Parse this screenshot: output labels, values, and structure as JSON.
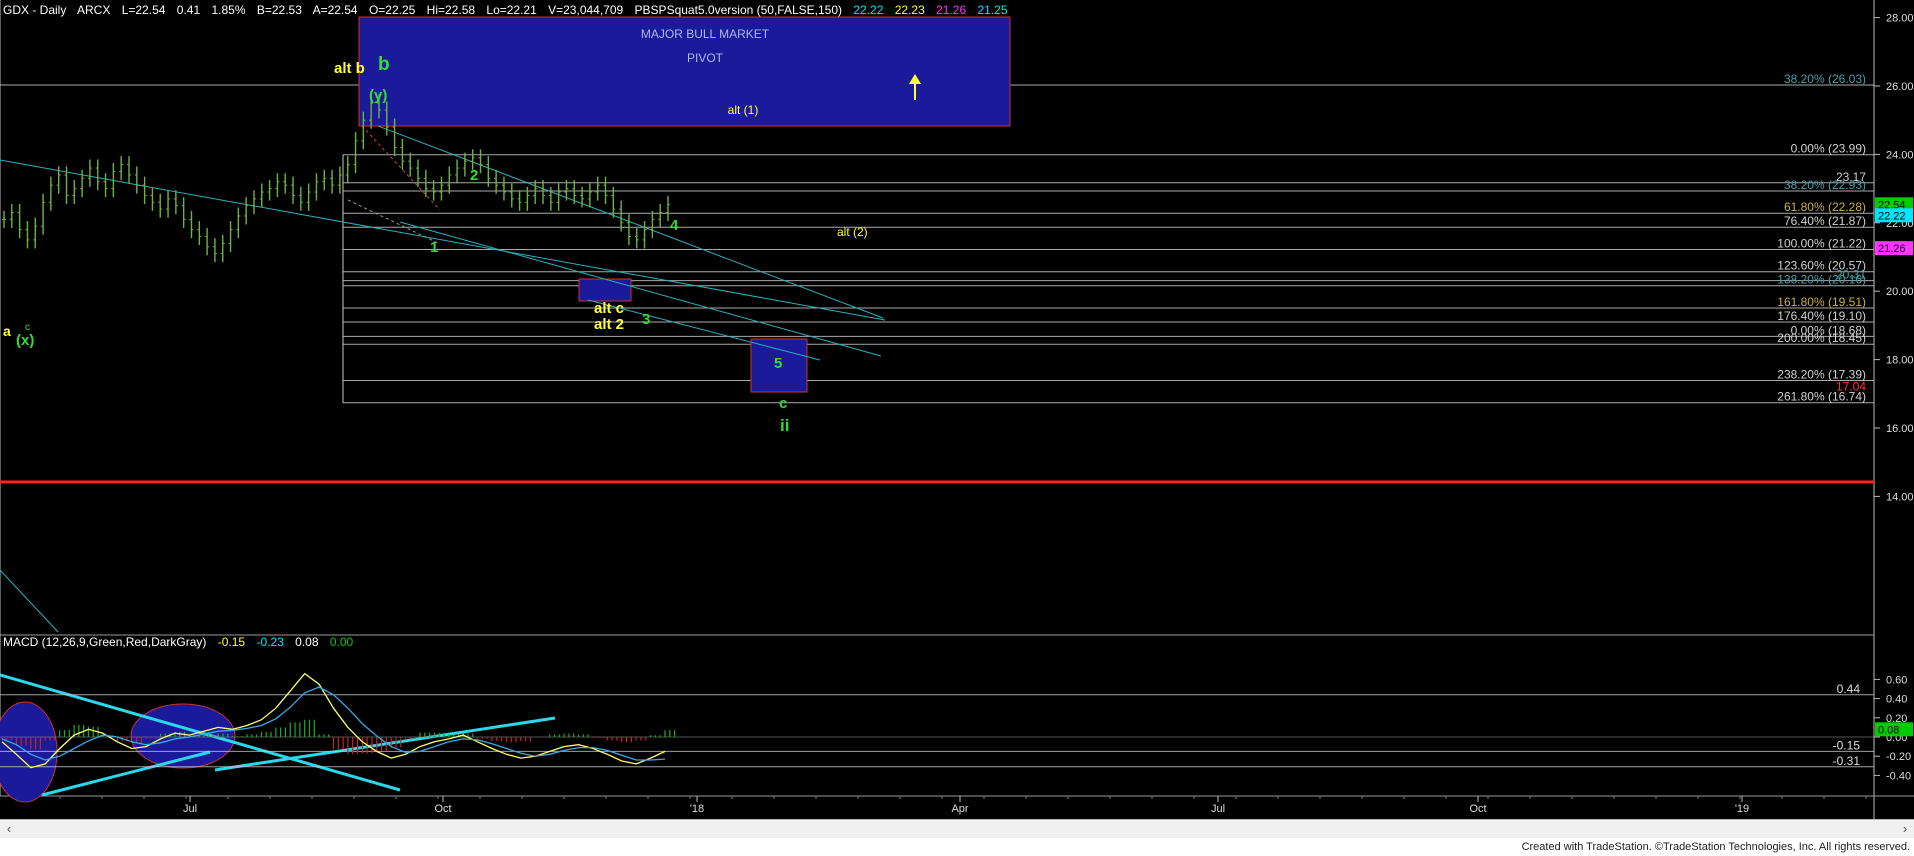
{
  "header": {
    "symbol": "GDX - Daily",
    "exchange": "ARCX",
    "last": "L=22.54",
    "change": "0.41",
    "change_pct": "1.85%",
    "bid": "B=22.53",
    "ask": "A=22.54",
    "open": "O=22.25",
    "high": "Hi=22.58",
    "low": "Lo=22.21",
    "volume": "V=23,044,709",
    "indicator": "PBSPSquat5.0version (50,FALSE,150)",
    "ind_values": [
      {
        "text": "22.22",
        "color": "#00e5ff"
      },
      {
        "text": "22.23",
        "color": "#ffff33"
      },
      {
        "text": "21.26",
        "color": "#ff33ff"
      },
      {
        "text": "21.25",
        "color": "#00e5ff"
      }
    ]
  },
  "macd": {
    "label": "MACD (12,26,9,Green,Red,DarkGray)",
    "values": [
      {
        "text": "-0.15",
        "color": "#ffff33"
      },
      {
        "text": "-0.23",
        "color": "#00e5ff"
      },
      {
        "text": "0.08",
        "color": "#ffffff"
      },
      {
        "text": "0.00",
        "color": "#00cc00"
      }
    ],
    "hline_labels": [
      {
        "text": "0.44",
        "v": 0.44
      },
      {
        "text": "-0.15",
        "v": -0.15
      },
      {
        "text": "-0.31",
        "v": -0.31
      }
    ],
    "last_badge": "0.08"
  },
  "zone": {
    "title": "MAJOR BULL MARKET",
    "subtitle": "PIVOT",
    "label": "alt (1)"
  },
  "price_badges": [
    {
      "text": "22.54",
      "v": 22.54,
      "bg": "#00cc00",
      "fg": "#000000"
    },
    {
      "text": "22.22",
      "v": 22.22,
      "bg": "#00e5ff",
      "fg": "#000000"
    },
    {
      "text": "21.26",
      "v": 21.26,
      "bg": "#ff33ff",
      "fg": "#000000"
    },
    {
      "text": "0.08",
      "v": 0.08,
      "bg": "#00cc00",
      "fg": "#000000"
    }
  ],
  "fib_labels": [
    {
      "text": "38.20% (26.03)",
      "v": 26.03,
      "color": "#46a0a8"
    },
    {
      "text": "0.00% (23.99)",
      "v": 23.99,
      "color": "#d0d0d0"
    },
    {
      "text": "23.17",
      "v": 23.17,
      "color": "#d0d0d0"
    },
    {
      "text": "38.20% (22.93)",
      "v": 22.93,
      "color": "#46a0a8"
    },
    {
      "text": "61.80% (22.28)",
      "v": 22.28,
      "color": "#c8b040"
    },
    {
      "text": "76.40% (21.87)",
      "v": 21.87,
      "color": "#d0d0d0"
    },
    {
      "text": "100.00% (21.22)",
      "v": 21.22,
      "color": "#d0d0d0"
    },
    {
      "text": "123.60% (20.57)",
      "v": 20.57,
      "color": "#d0d0d0"
    },
    {
      "text": "20.31",
      "v": 20.31,
      "color": "#46a0a8"
    },
    {
      "text": "138.20% (20.16)",
      "v": 20.16,
      "color": "#46a0a8"
    },
    {
      "text": "161.80% (19.51)",
      "v": 19.51,
      "color": "#c8b040"
    },
    {
      "text": "176.40% (19.10)",
      "v": 19.1,
      "color": "#d0d0d0"
    },
    {
      "text": "0.00% (18.68)",
      "v": 18.68,
      "color": "#d0d0d0"
    },
    {
      "text": "200.00% (18.45)",
      "v": 18.45,
      "color": "#d0d0d0"
    },
    {
      "text": "238.20% (17.39)",
      "v": 17.39,
      "color": "#d0d0d0"
    },
    {
      "text": "17.04",
      "v": 17.04,
      "color": "#ff3333"
    },
    {
      "text": "261.80% (16.74)",
      "v": 16.74,
      "color": "#d0d0d0"
    }
  ],
  "wave_labels": [
    {
      "text": "alt b",
      "color": "#ffff33"
    },
    {
      "text": "b",
      "color": "#33dd33"
    },
    {
      "text": "(y)",
      "color": "#33dd33"
    },
    {
      "text": "2",
      "color": "#33dd33"
    },
    {
      "text": "1",
      "color": "#33dd33"
    },
    {
      "text": "4",
      "color": "#33dd33"
    },
    {
      "text": "alt (2)",
      "color": "#ffff33"
    },
    {
      "text": "alt c",
      "color": "#ffff33"
    },
    {
      "text": "alt 2",
      "color": "#ffff33"
    },
    {
      "text": "3",
      "color": "#33dd33"
    },
    {
      "text": "5",
      "color": "#33dd33"
    },
    {
      "text": "c",
      "color": "#33dd33"
    },
    {
      "text": "ii",
      "color": "#33dd33"
    },
    {
      "text": "a",
      "color": "#ffff33"
    },
    {
      "text": "c",
      "color": "#33dd33"
    },
    {
      "text": "(x)",
      "color": "#33dd33"
    }
  ],
  "footer": {
    "text": "Created with TradeStation. ©TradeStation Technologies, Inc. All rights reserved."
  },
  "chart_data": [
    {
      "type": "ohlc",
      "title": "GDX - Daily",
      "y_axis_ticks": [
        "28.00",
        "26.00",
        "24.00",
        "22.00",
        "20.00",
        "18.00",
        "16.00",
        "14.00"
      ],
      "ylim": [
        13.2,
        28.3
      ],
      "x_axis_ticks": [
        "Jul",
        "Oct",
        "'18",
        "Apr",
        "Jul",
        "Oct",
        "'19"
      ],
      "close": [
        22.1,
        22.3,
        21.8,
        21.5,
        21.9,
        22.6,
        23.1,
        23.4,
        22.8,
        23.0,
        23.3,
        23.6,
        23.2,
        23.0,
        23.5,
        23.7,
        23.4,
        23.1,
        22.8,
        22.6,
        22.4,
        22.7,
        22.5,
        22.1,
        21.8,
        21.6,
        21.3,
        21.1,
        21.4,
        21.8,
        22.2,
        22.5,
        22.7,
        22.9,
        23.0,
        23.2,
        23.1,
        22.8,
        22.6,
        22.9,
        23.2,
        23.3,
        23.1,
        23.4,
        23.7,
        24.4,
        25.0,
        25.5,
        25.3,
        24.8,
        24.2,
        23.8,
        23.6,
        23.3,
        23.0,
        22.9,
        23.1,
        23.4,
        23.6,
        23.8,
        23.9,
        23.7,
        23.3,
        23.1,
        22.9,
        22.7,
        22.6,
        22.8,
        23.0,
        22.8,
        22.6,
        22.9,
        23.0,
        22.8,
        22.7,
        22.9,
        23.1,
        22.8,
        22.4,
        22.0,
        21.6,
        21.5,
        21.8,
        22.1,
        22.3,
        22.54
      ],
      "waves": [
        "alt b",
        "b",
        "(y)",
        "1",
        "2",
        "alt c",
        "alt 2",
        "3",
        "4",
        "5",
        "c",
        "ii",
        "alt (2)",
        "a",
        "c",
        "(x)"
      ]
    },
    {
      "type": "macd",
      "title": "MACD (12,26,9,Green,Red,DarkGray)",
      "y_axis_ticks": [
        "0.60",
        "0.40",
        "0.20",
        "0.00",
        "-0.20",
        "-0.40"
      ],
      "ylim": [
        -0.5,
        0.68
      ],
      "macd": [
        -0.05,
        -0.18,
        -0.32,
        -0.28,
        -0.12,
        0.02,
        0.08,
        0.04,
        -0.05,
        -0.12,
        -0.1,
        -0.02,
        0.04,
        0.02,
        0.06,
        0.1,
        0.08,
        0.12,
        0.18,
        0.3,
        0.48,
        0.66,
        0.55,
        0.3,
        0.1,
        -0.05,
        -0.15,
        -0.22,
        -0.18,
        -0.1,
        -0.05,
        -0.02,
        0.02,
        -0.05,
        -0.12,
        -0.18,
        -0.22,
        -0.2,
        -0.15,
        -0.1,
        -0.08,
        -0.12,
        -0.18,
        -0.25,
        -0.28,
        -0.22,
        -0.15
      ],
      "signal": [
        -0.02,
        -0.08,
        -0.18,
        -0.24,
        -0.2,
        -0.12,
        -0.04,
        0.02,
        0.0,
        -0.05,
        -0.08,
        -0.06,
        -0.02,
        0.0,
        0.03,
        0.06,
        0.07,
        0.09,
        0.12,
        0.19,
        0.31,
        0.46,
        0.52,
        0.44,
        0.3,
        0.14,
        0.01,
        -0.1,
        -0.16,
        -0.15,
        -0.1,
        -0.05,
        -0.02,
        -0.03,
        -0.07,
        -0.12,
        -0.17,
        -0.2,
        -0.18,
        -0.14,
        -0.11,
        -0.11,
        -0.14,
        -0.19,
        -0.24,
        -0.24,
        -0.23
      ]
    }
  ]
}
